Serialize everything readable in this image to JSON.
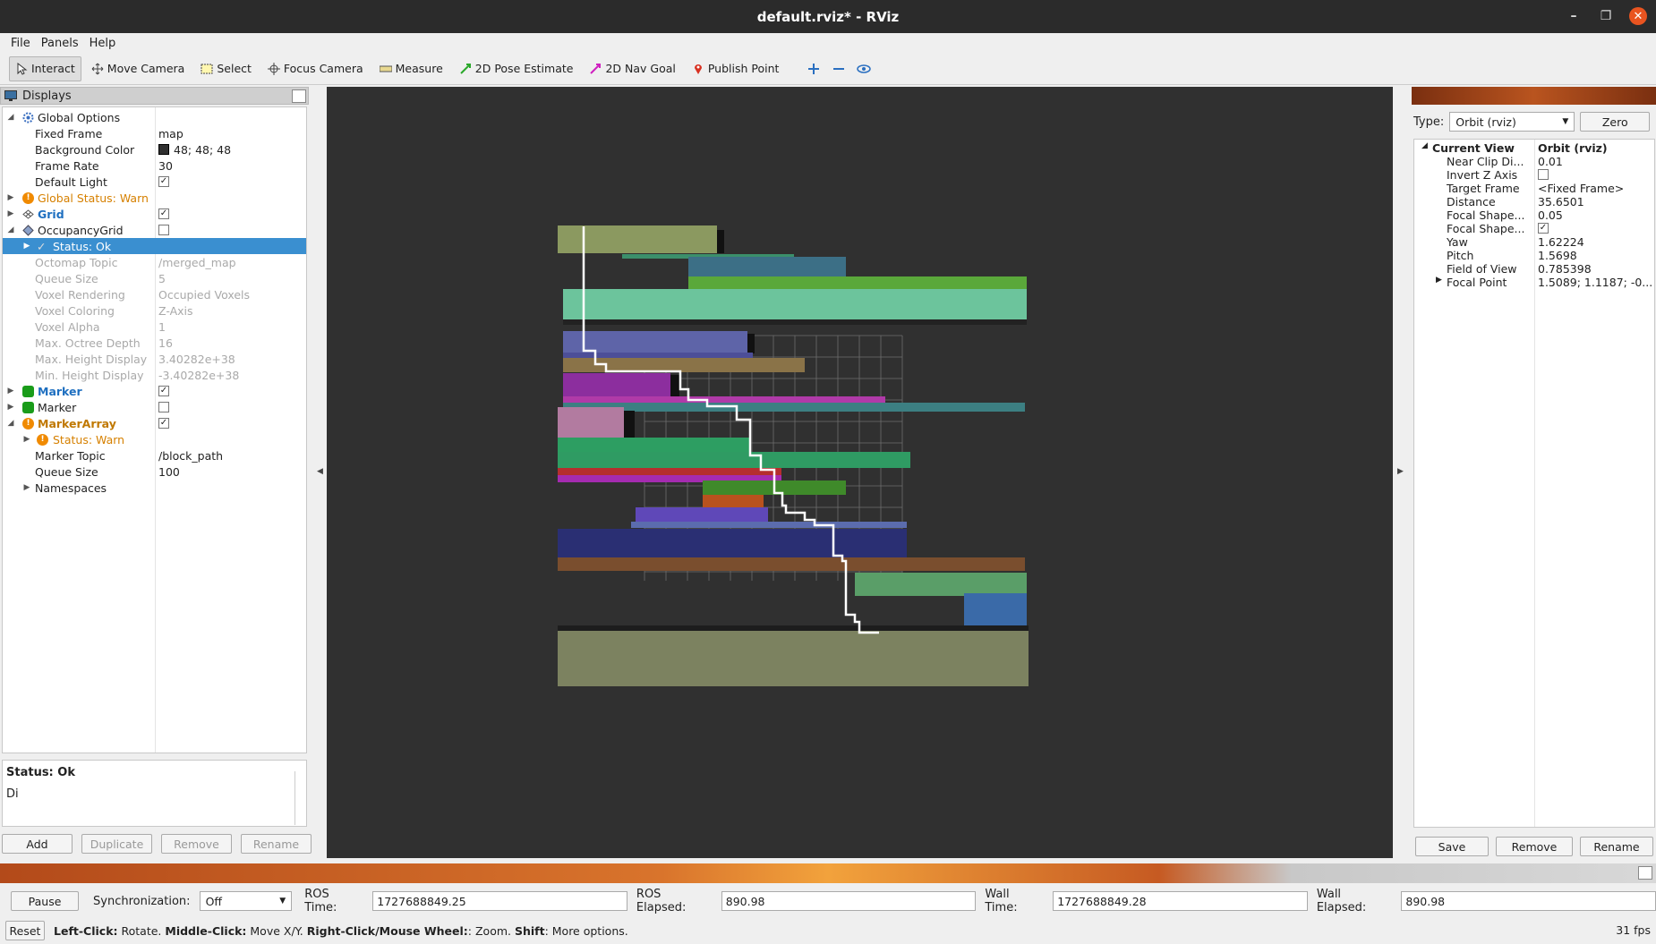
{
  "window": {
    "title": "default.rviz* - RViz"
  },
  "menu": [
    "File",
    "Panels",
    "Help"
  ],
  "toolbar": {
    "tools": [
      "Interact",
      "Move Camera",
      "Select",
      "Focus Camera",
      "Measure",
      "2D Pose Estimate",
      "2D Nav Goal",
      "Publish Point"
    ]
  },
  "displays": {
    "title": "Displays",
    "rows": [
      {
        "label": "Global Options",
        "value": ""
      },
      {
        "label": "Fixed Frame",
        "value": "map"
      },
      {
        "label": "Background Color",
        "value": "48; 48; 48"
      },
      {
        "label": "Frame Rate",
        "value": "30"
      },
      {
        "label": "Default Light",
        "value": ""
      },
      {
        "label": "Global Status: Warn",
        "value": ""
      },
      {
        "label": "Grid",
        "value": ""
      },
      {
        "label": "OccupancyGrid",
        "value": ""
      },
      {
        "label": "Status: Ok",
        "value": ""
      },
      {
        "label": "Octomap Topic",
        "value": "/merged_map"
      },
      {
        "label": "Queue Size",
        "value": "5"
      },
      {
        "label": "Voxel Rendering",
        "value": "Occupied Voxels"
      },
      {
        "label": "Voxel Coloring",
        "value": "Z-Axis"
      },
      {
        "label": "Voxel Alpha",
        "value": "1"
      },
      {
        "label": "Max. Octree Depth",
        "value": "16"
      },
      {
        "label": "Max. Height Display",
        "value": "3.40282e+38"
      },
      {
        "label": "Min. Height Display",
        "value": "-3.40282e+38"
      },
      {
        "label": "Marker",
        "value": ""
      },
      {
        "label": "Marker",
        "value": ""
      },
      {
        "label": "MarkerArray",
        "value": ""
      },
      {
        "label": "Status: Warn",
        "value": ""
      },
      {
        "label": "Marker Topic",
        "value": "/block_path"
      },
      {
        "label": "Queue Size",
        "value": "100"
      },
      {
        "label": "Namespaces",
        "value": ""
      }
    ],
    "status_title": "Status: Ok",
    "status_desc": "Di",
    "buttons": [
      "Add",
      "Duplicate",
      "Remove",
      "Rename"
    ]
  },
  "views": {
    "type_label": "Type:",
    "type_value": "Orbit (rviz)",
    "zero_label": "Zero",
    "rows": [
      {
        "label": "Current View",
        "value": "Orbit (rviz)"
      },
      {
        "label": "Near Clip Di...",
        "value": "0.01"
      },
      {
        "label": "Invert Z Axis",
        "value": ""
      },
      {
        "label": "Target Frame",
        "value": "<Fixed Frame>"
      },
      {
        "label": "Distance",
        "value": "35.6501"
      },
      {
        "label": "Focal Shape...",
        "value": "0.05"
      },
      {
        "label": "Focal Shape...",
        "value": ""
      },
      {
        "label": "Yaw",
        "value": "1.62224"
      },
      {
        "label": "Pitch",
        "value": "1.5698"
      },
      {
        "label": "Field of View",
        "value": "0.785398"
      },
      {
        "label": "Focal Point",
        "value": "1.5089; 1.1187; -0...."
      }
    ],
    "buttons": [
      "Save",
      "Remove",
      "Rename"
    ]
  },
  "time": {
    "pause": "Pause",
    "sync_label": "Synchronization:",
    "sync_value": "Off",
    "ros_time_label": "ROS Time:",
    "ros_time": "1727688849.25",
    "ros_elapsed_label": "ROS Elapsed:",
    "ros_elapsed": "890.98",
    "wall_time_label": "Wall Time:",
    "wall_time": "1727688849.28",
    "wall_elapsed_label": "Wall Elapsed:",
    "wall_elapsed": "890.98"
  },
  "hint": {
    "reset": "Reset",
    "b1": "Left-Click:",
    "t1": " Rotate. ",
    "b2": "Middle-Click:",
    "t2": " Move X/Y. ",
    "b3": "Right-Click/Mouse Wheel:",
    "t3": ": Zoom. ",
    "b4": "Shift",
    "t4": ": More options."
  },
  "fps": "31 fps",
  "colors": {
    "accent": "#3a8fd0",
    "warn": "#d68000",
    "close": "#e95420",
    "bg3d": "#303030"
  }
}
